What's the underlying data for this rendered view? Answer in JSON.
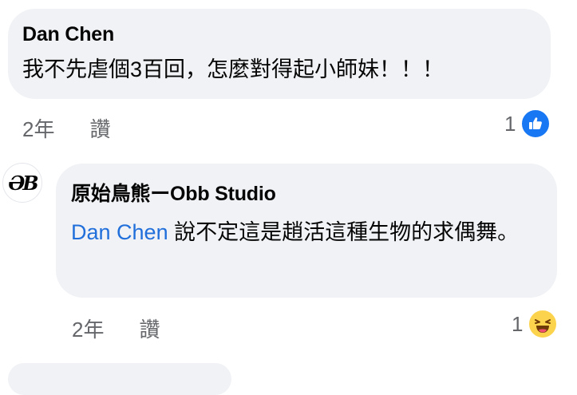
{
  "comment": {
    "author": "Dan Chen",
    "text": "我不先虐個3百回，怎麼對得起小師妹！！！",
    "time": "2年",
    "like_label": "讚",
    "reaction_count": "1",
    "reaction_icon": "like-icon"
  },
  "reply": {
    "avatar_text": "ƏB",
    "author": "原始鳥熊ーObb Studio",
    "mention": "Dan Chen",
    "text": " 說不定這是趙活這種生物的求偶舞。",
    "time": "2年",
    "like_label": "讚",
    "reaction_count": "1",
    "reaction_icon": "haha-icon"
  },
  "colors": {
    "bubble": "#f0f2f5",
    "mention": "#216fdb",
    "meta": "#65676b",
    "like": "#1877f2",
    "haha": "#fcd34d"
  }
}
